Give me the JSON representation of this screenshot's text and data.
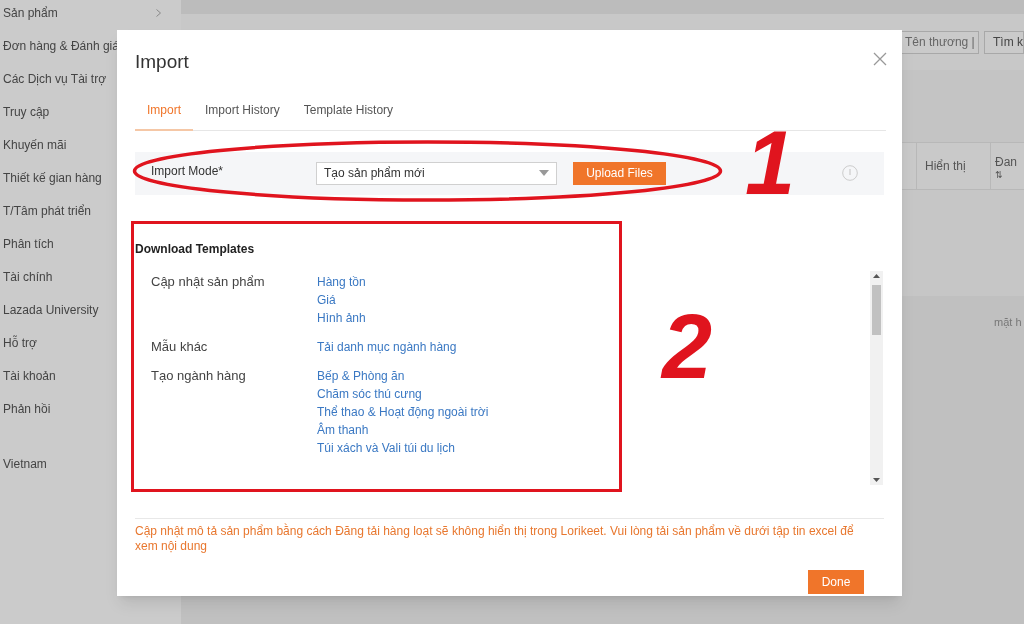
{
  "sidebar": {
    "items": [
      "Sản phẩm",
      "Đơn hàng & Đánh giá",
      "Các Dịch vụ Tài trợ",
      "Truy cập",
      "Khuyến mãi",
      "Thiết kế gian hàng",
      "T/Tâm phát triển",
      "Phân tích",
      "Tài chính",
      "Lazada University",
      "Hỗ trợ",
      "Tài khoản",
      "Phản hồi"
    ],
    "country": "Vietnam"
  },
  "background": {
    "search_field": {
      "value": "Tên thương |"
    },
    "search_button": "Tìm k",
    "table_headers": [
      "Hiển thị",
      "Đan"
    ],
    "sort_icon": "⇅",
    "body_text": "mặt h"
  },
  "dialog": {
    "title": "Import",
    "tabs": [
      {
        "label": "Import",
        "selected": true
      },
      {
        "label": "Import History",
        "selected": false
      },
      {
        "label": "Template History",
        "selected": false
      }
    ],
    "import_mode": {
      "label": "Import Mode*",
      "value": "Tạo sản phẩm mới",
      "button": "Upload Files"
    },
    "templates": {
      "heading": "Download Templates",
      "groups": [
        {
          "label": "Cập nhật sản phẩm",
          "links": [
            "Hàng tồn",
            "Giá",
            "Hình ảnh"
          ]
        },
        {
          "label": "Mẫu khác",
          "links": [
            "Tải danh mục ngành hàng"
          ]
        },
        {
          "label": "Tạo ngành hàng",
          "links": [
            "Bếp & Phòng ăn",
            "Chăm sóc thú cưng",
            "Thể thao & Hoạt động ngoài trời",
            "Âm thanh",
            "Túi xách và Vali túi du lịch"
          ]
        }
      ]
    },
    "notice": "Cập nhật mô tả sản phẩm bằng cách Đăng tải hàng loạt sẽ không hiển thị trong Lorikeet. Vui lòng tải sản phẩm về dưới tập tin excel để xem nội dung",
    "done_button": "Done"
  },
  "annotations": {
    "numbers": [
      "1",
      "2"
    ]
  }
}
